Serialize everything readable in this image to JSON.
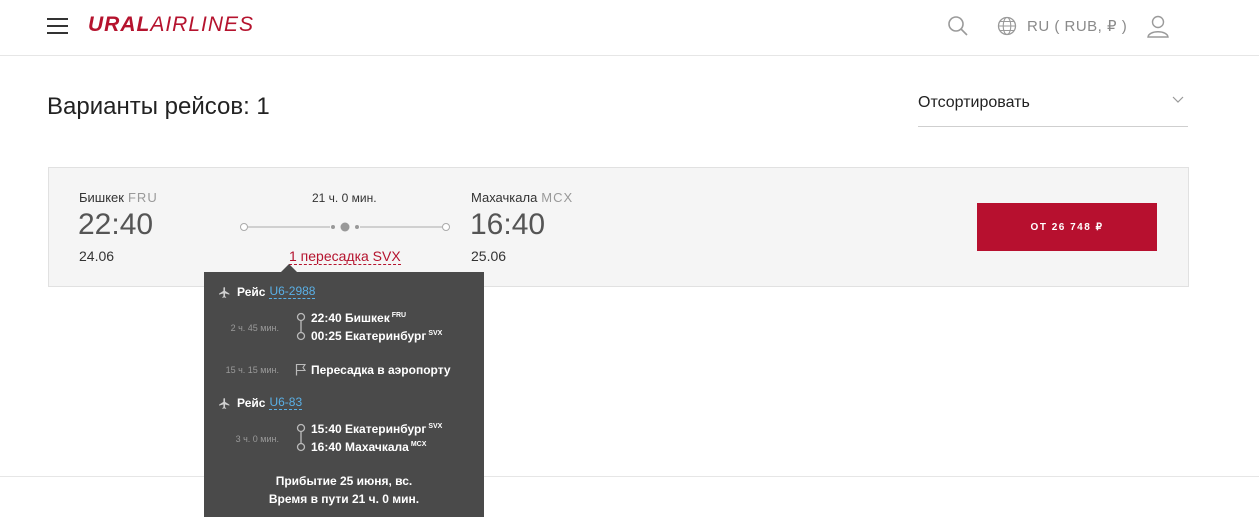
{
  "header": {
    "logo_bold": "URAL",
    "logo_light": "AIRLINES",
    "language": "RU ( RUB, ₽ )",
    "accent_color": "#b5132e"
  },
  "results": {
    "title": "Варианты рейсов: 1",
    "sort_label": "Отсортировать"
  },
  "flight": {
    "origin_city": "Бишкек",
    "origin_code": "FRU",
    "departure_time": "22:40",
    "departure_date": "24.06",
    "duration": "21 ч. 0 мин.",
    "transfer_label": "1 пересадка SVX",
    "destination_city": "Махачкала",
    "destination_code": "MCX",
    "arrival_time": "16:40",
    "arrival_date": "25.06",
    "price_button": "ОТ 26 748 ₽",
    "button_color": "#b7102f"
  },
  "tooltip": {
    "segment1": {
      "label": "Рейс",
      "flight_no": "U6-2988",
      "duration": "2 ч. 45 мин.",
      "dep": "22:40 Бишкек",
      "dep_code": "FRU",
      "arr": "00:25 Екатеринбург",
      "arr_code": "SVX"
    },
    "transfer": {
      "duration": "15 ч. 15 мин.",
      "label": "Пересадка в аэропорту"
    },
    "segment2": {
      "label": "Рейс",
      "flight_no": "U6-83",
      "duration": "3 ч. 0 мин.",
      "dep": "15:40 Екатеринбург",
      "dep_code": "SVX",
      "arr": "16:40 Махачкала",
      "arr_code": "MCX"
    },
    "arrival_line": "Прибытие 25 июня, вс.",
    "total_line": "Время в пути 21 ч. 0 мин."
  }
}
